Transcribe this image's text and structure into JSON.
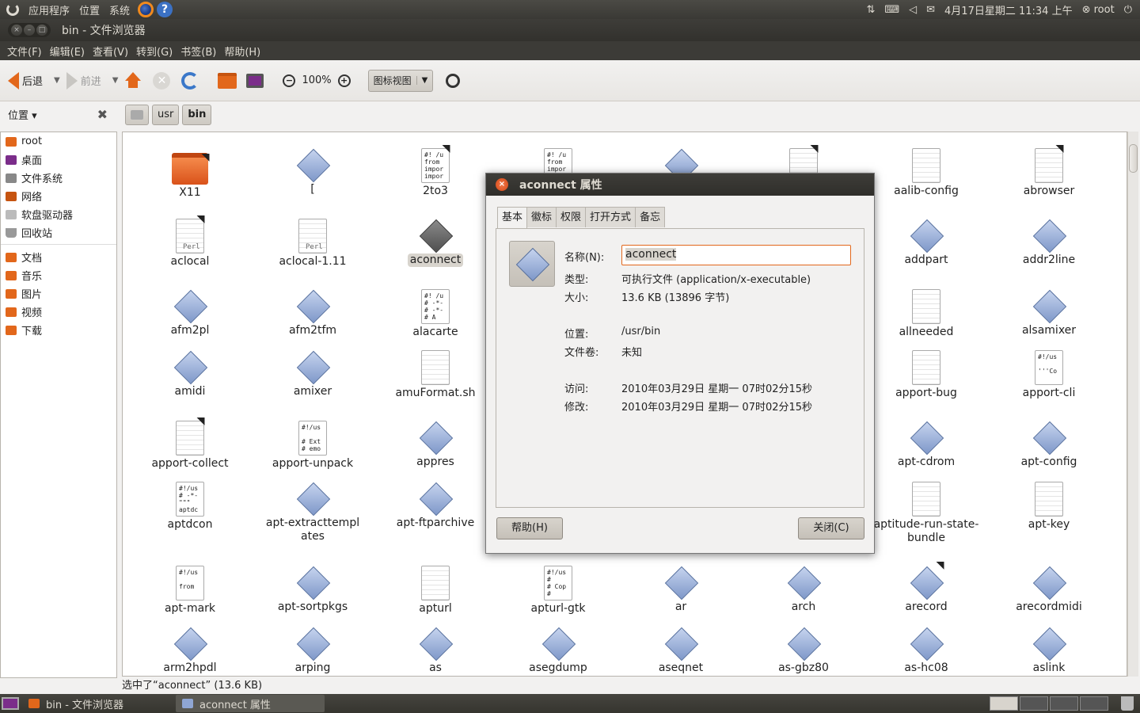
{
  "top_panel": {
    "menus": [
      "应用程序",
      "位置",
      "系统"
    ],
    "datetime": "4月17日星期二 11:34 上午",
    "user": "root"
  },
  "window": {
    "title": "bin - 文件浏览器"
  },
  "menubar": [
    "文件(F)",
    "编辑(E)",
    "查看(V)",
    "转到(G)",
    "书签(B)",
    "帮助(H)"
  ],
  "toolbar": {
    "back_label": "后退",
    "forward_label": "前进",
    "zoom": "100%",
    "view_mode": "图标视图"
  },
  "sidebar": {
    "title": "位置",
    "items": [
      "root",
      "桌面",
      "文件系统",
      "网络",
      "软盘驱动器",
      "回收站"
    ],
    "bookmarks": [
      "文档",
      "音乐",
      "图片",
      "视频",
      "下载"
    ]
  },
  "pathbar": {
    "segments": [
      "usr",
      "bin"
    ]
  },
  "files": {
    "row1": [
      "X11",
      "[",
      "2to3",
      "aalib-config",
      "abrowser"
    ],
    "row2": [
      "aclocal",
      "aclocal-1.11",
      "aconnect",
      "addpart",
      "addr2line"
    ],
    "row3": [
      "afm2pl",
      "afm2tfm",
      "alacarte",
      "allneeded",
      "alsamixer"
    ],
    "row4": [
      "amidi",
      "amixer",
      "amuFormat.sh",
      "apport-bug",
      "apport-cli"
    ],
    "row5": [
      "apport-collect",
      "apport-unpack",
      "appres",
      "apt-cdrom",
      "apt-config"
    ],
    "row6": [
      "aptdcon",
      "apt-extracttemplates",
      "apt-ftparchive",
      "aptitude-run-state-bundle",
      "apt-key"
    ],
    "row7": [
      "apt-mark",
      "apt-sortpkgs",
      "apturl",
      "apturl-gtk",
      "ar",
      "arch",
      "arecord",
      "arecordmidi"
    ],
    "row8": [
      "arm2hpdl",
      "arping",
      "as",
      "asegdump",
      "aseqnet",
      "as-gbz80",
      "as-hc08",
      "aslink"
    ],
    "script_snippets": {
      "2to3": [
        "#! /u",
        "from",
        "impor",
        "impor"
      ],
      "alacarte": [
        "#! /u",
        "# -*-",
        "# -*-",
        "#   A"
      ],
      "apport-cli": [
        "#!/us",
        "",
        "'''Co"
      ],
      "apport-unpack": [
        "#!/us",
        "",
        "# Ext",
        "# emo"
      ],
      "aptdcon": [
        "#!/us",
        "# -*-",
        "\"\"\"",
        "aptdc"
      ],
      "apt-mark": [
        "#!/us",
        "",
        "from"
      ],
      "apturl-gtk": [
        "#!/us",
        "#",
        "# Cop",
        "#"
      ],
      "hidden": [
        "#! /u",
        "from",
        "impor"
      ]
    }
  },
  "status": "选中了“aconnect” (13.6 KB)",
  "taskbar": [
    "bin - 文件浏览器",
    "aconnect 属性"
  ],
  "dialog": {
    "title": "aconnect 属性",
    "tabs": [
      "基本",
      "徽标",
      "权限",
      "打开方式",
      "备忘"
    ],
    "name_label": "名称(N):",
    "name_value": "aconnect",
    "type_label": "类型:",
    "type_value": "可执行文件 (application/x-executable)",
    "size_label": "大小:",
    "size_value": "13.6 KB (13896 字节)",
    "location_label": "位置:",
    "location_value": "/usr/bin",
    "volume_label": "文件卷:",
    "volume_value": "未知",
    "accessed_label": "访问:",
    "accessed_value": "2010年03月29日 星期一 07时02分15秒",
    "modified_label": "修改:",
    "modified_value": "2010年03月29日 星期一 07时02分15秒",
    "help_button": "帮助(H)",
    "close_button": "关闭(C)"
  },
  "colors": {
    "accent": "#e2671b",
    "panel_dark": "#3c3b37",
    "window_bg": "#f2f1f0"
  }
}
